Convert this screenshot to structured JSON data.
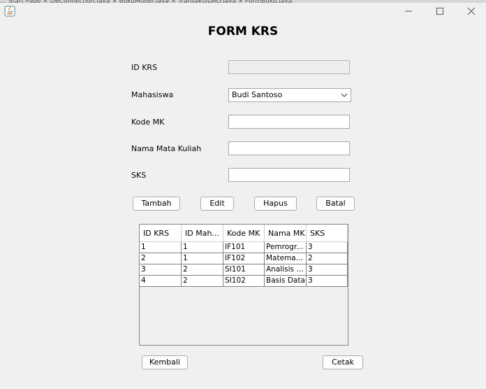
{
  "window": {
    "background_tabs": "…   Start Page  ×   DBConnection.java  ×   BukuModel.java  ×   TransaksiDAO.java  ×   FormBuku.java",
    "icon": "java-icon",
    "controls": {
      "minimize": "minimize-icon",
      "maximize": "maximize-icon",
      "close": "close-icon"
    }
  },
  "form": {
    "title": "FORM KRS",
    "fields": {
      "id_krs": {
        "label": "ID KRS",
        "value": ""
      },
      "mahasiswa": {
        "label": "Mahasiswa",
        "value": "Budi Santoso"
      },
      "kode_mk": {
        "label": "Kode MK",
        "value": ""
      },
      "nama_mk": {
        "label": "Nama Mata Kuliah",
        "value": ""
      },
      "sks": {
        "label": "SKS",
        "value": ""
      }
    },
    "buttons": {
      "tambah": "Tambah",
      "edit": "Edit",
      "hapus": "Hapus",
      "batal": "Batal"
    }
  },
  "table": {
    "columns": [
      "ID KRS",
      "ID Mah...",
      "Kode MK",
      "Nama MK",
      "SKS"
    ],
    "rows": [
      [
        "1",
        "1",
        "IF101",
        "Pemrogr...",
        "3"
      ],
      [
        "2",
        "1",
        "IF102",
        "Matemati...",
        "2"
      ],
      [
        "3",
        "2",
        "SI101",
        "Analisis S...",
        "3"
      ],
      [
        "4",
        "2",
        "SI102",
        "Basis Data",
        "3"
      ]
    ]
  },
  "footer": {
    "kembali": "Kembali",
    "cetak": "Cetak"
  }
}
